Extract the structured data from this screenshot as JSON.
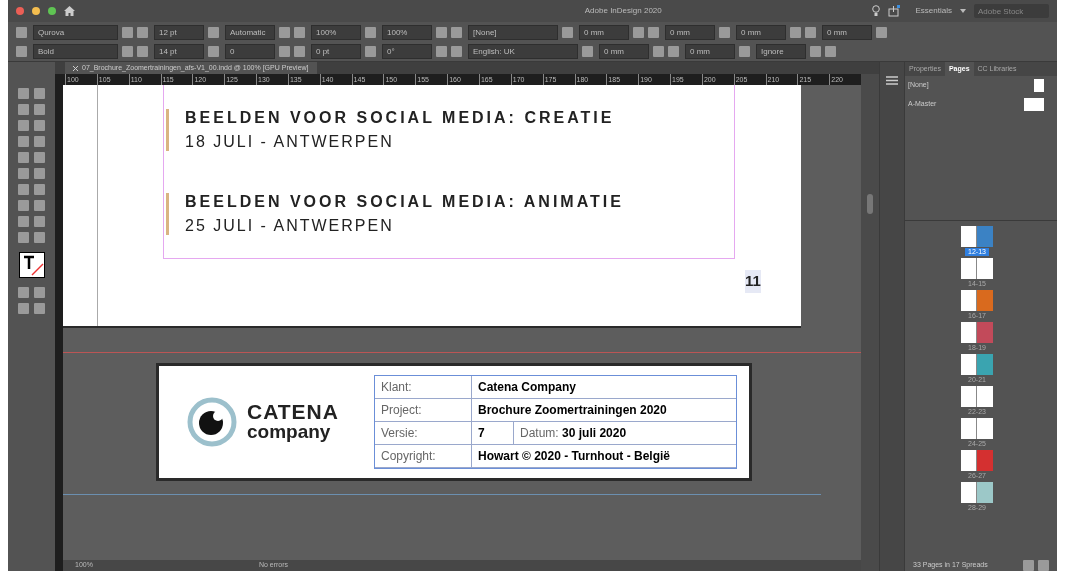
{
  "window": {
    "title": "Adobe InDesign 2020"
  },
  "control_panel": {
    "row1": [
      {
        "kind": "field",
        "value": "Qurova"
      },
      {
        "kind": "field",
        "value": "12 pt"
      },
      {
        "kind": "field",
        "value": "Automatic"
      },
      {
        "kind": "field",
        "value": "100%"
      },
      {
        "kind": "field",
        "value": "100%"
      },
      {
        "kind": "field",
        "value": "[None]"
      },
      {
        "kind": "field",
        "value": "0 mm"
      },
      {
        "kind": "field",
        "value": "0 mm"
      },
      {
        "kind": "field",
        "value": "0 mm"
      },
      {
        "kind": "field",
        "value": "0 mm"
      }
    ],
    "row2": [
      {
        "kind": "field",
        "value": "Bold"
      },
      {
        "kind": "field",
        "value": "14 pt"
      },
      {
        "kind": "field",
        "value": "0"
      },
      {
        "kind": "field",
        "value": "0 pt"
      },
      {
        "kind": "field",
        "value": "0°"
      },
      {
        "kind": "field",
        "value": "English: UK"
      },
      {
        "kind": "field",
        "value": "0 mm"
      },
      {
        "kind": "field",
        "value": "0 mm"
      },
      {
        "kind": "field",
        "value": "Ignore"
      }
    ]
  },
  "search": {
    "placeholder": "Adobe Stock"
  },
  "workspace": "Essentials",
  "document_tab": "07_Brochure_Zoomertrainingen_afs-V1_00.indd @ 100% [GPU Preview]",
  "ruler": [
    "100",
    "105",
    "110",
    "115",
    "120",
    "125",
    "130",
    "135",
    "140",
    "145",
    "150",
    "155",
    "160",
    "165",
    "170",
    "175",
    "180",
    "185",
    "190",
    "195",
    "200",
    "205",
    "210",
    "215",
    "220"
  ],
  "page": {
    "events": [
      {
        "title": "BEELDEN VOOR SOCIAL MEDIA: CREATIE",
        "date": "18 JULI - ANTWERPEN"
      },
      {
        "title": "BEELDEN VOOR SOCIAL MEDIA: ANIMATIE",
        "date": "25 JULI - ANTWERPEN"
      }
    ],
    "page_number": "11"
  },
  "footer": {
    "logo_line1": "CATENA",
    "logo_line2": "company",
    "rows": [
      {
        "label": "Klant:",
        "value": "Catena Company"
      },
      {
        "label": "Project:",
        "value": "Brochure Zoomertrainingen 2020"
      },
      {
        "label": "Versie:",
        "value": "7",
        "extra_label": "Datum:",
        "extra_value": "30 juli 2020"
      },
      {
        "label": "Copyright:",
        "value": "Howart © 2020 - Turnhout - België"
      }
    ]
  },
  "panel": {
    "tabs": [
      {
        "label": "Properties",
        "selected": false
      },
      {
        "label": "Pages",
        "selected": true
      },
      {
        "label": "CC Libraries",
        "selected": false
      }
    ],
    "masters": [
      "[None]",
      "A-Master"
    ],
    "spreads": [
      {
        "label": "12-13",
        "selected": true,
        "color": "#3b82c4"
      },
      {
        "label": "14-15",
        "selected": false,
        "color": "#ffffff"
      },
      {
        "label": "16-17",
        "selected": false,
        "color": "#d96a1e"
      },
      {
        "label": "18-19",
        "selected": false,
        "color": "#c24a5a"
      },
      {
        "label": "20-21",
        "selected": false,
        "color": "#3aa4b0"
      },
      {
        "label": "22-23",
        "selected": false,
        "color": "#ffffff"
      },
      {
        "label": "24-25",
        "selected": false,
        "color": "#ffffff"
      },
      {
        "label": "26-27",
        "selected": false,
        "color": "#d43030"
      },
      {
        "label": "28-29",
        "selected": false,
        "color": "#9cc8c8"
      }
    ],
    "footer": "33 Pages in 17 Spreads"
  },
  "status": {
    "zoom": "100%",
    "preflight": "No errors"
  }
}
